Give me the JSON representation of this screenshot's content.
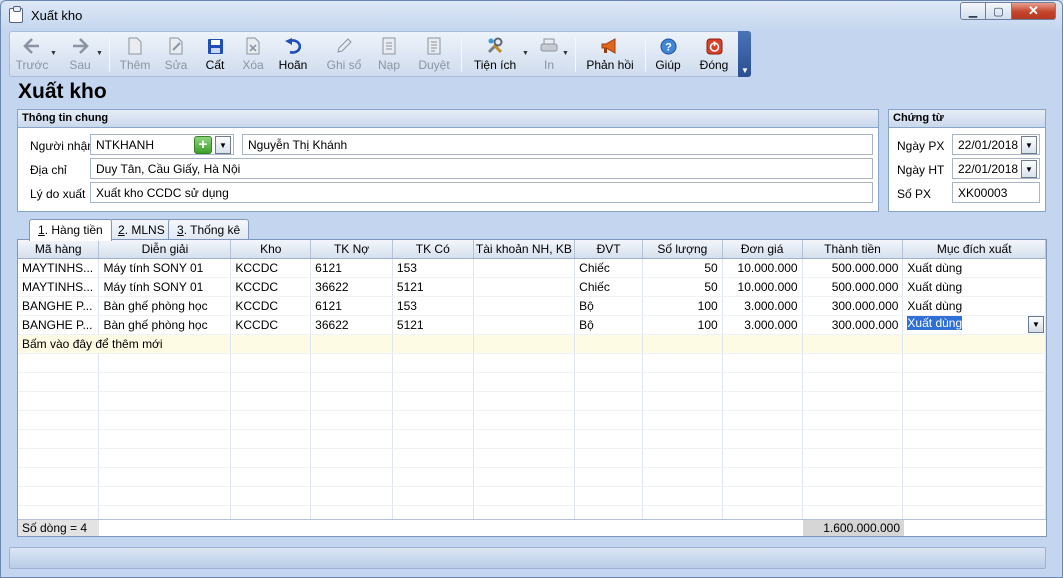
{
  "window": {
    "title": "Xuất kho"
  },
  "toolbar": {
    "truoc": "Trước",
    "sau": "Sau",
    "them": "Thêm",
    "sua": "Sửa",
    "cat": "Cất",
    "xoa": "Xóa",
    "hoan": "Hoãn",
    "ghiso": "Ghi sổ",
    "nap": "Nạp",
    "duyet": "Duyệt",
    "tienich": "Tiện ích",
    "in": "In",
    "phanhoi": "Phản hồi",
    "giup": "Giúp",
    "dong": "Đóng"
  },
  "form": {
    "title": "Xuất kho"
  },
  "general": {
    "heading": "Thông tin chung",
    "recipient_label": "Người nhận",
    "recipient_code": "NTKHANH",
    "recipient_name": "Nguyễn Thị Khánh",
    "address_label": "Địa chỉ",
    "address": "Duy Tân, Cầu Giấy, Hà Nội",
    "reason_label": "Lý do xuất",
    "reason": "Xuất kho CCDC sử dụng"
  },
  "voucher": {
    "heading": "Chứng từ",
    "date_px_label": "Ngày PX",
    "date_px": "22/01/2018",
    "date_ht_label": "Ngày HT",
    "date_ht": "22/01/2018",
    "no_label": "Số PX",
    "no": "XK00003"
  },
  "tabs": [
    {
      "num": "1",
      "label": ". Hàng tiền"
    },
    {
      "num": "2",
      "label": ". MLNS"
    },
    {
      "num": "3",
      "label": ". Thống kê"
    }
  ],
  "grid": {
    "columns": [
      "Mã hàng",
      "Diễn giải",
      "Kho",
      "TK Nợ",
      "TK Có",
      "Tài khoản NH, KB",
      "ĐVT",
      "Số lượng",
      "Đơn giá",
      "Thành tiền",
      "Mục đích xuất"
    ],
    "rows": [
      [
        "MAYTINHS...",
        "Máy tính SONY 01",
        "KCCDC",
        "6121",
        "153",
        "",
        "Chiếc",
        "50",
        "10.000.000",
        "500.000.000",
        "Xuất dùng"
      ],
      [
        "MAYTINHS...",
        "Máy tính SONY 01",
        "KCCDC",
        "36622",
        "5121",
        "",
        "Chiếc",
        "50",
        "10.000.000",
        "500.000.000",
        "Xuất dùng"
      ],
      [
        "BANGHE P...",
        "Bàn ghế phòng học",
        "KCCDC",
        "6121",
        "153",
        "",
        "Bộ",
        "100",
        "3.000.000",
        "300.000.000",
        "Xuất dùng"
      ],
      [
        "BANGHE P...",
        "Bàn ghế phòng học",
        "KCCDC",
        "36622",
        "5121",
        "",
        "Bộ",
        "100",
        "3.000.000",
        "300.000.000",
        "Xuất dùng"
      ]
    ],
    "add_row_text": "Bấm vào đây để thêm mới",
    "row_count": "Số dòng = 4",
    "total": "1.600.000.000"
  },
  "colors": {
    "accent": "#2f6fd6",
    "close": "#c4442b",
    "toolbar_corner": "#2a4f92"
  }
}
